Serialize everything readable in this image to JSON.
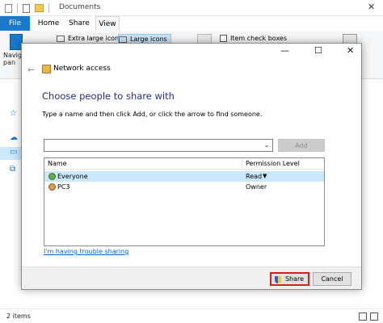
{
  "explorer": {
    "title": "Documents",
    "tabs": {
      "file": "File",
      "home": "Home",
      "share": "Share",
      "view": "View"
    },
    "ribbon": {
      "nav_pane_label": "Navig pan",
      "layout_extra_large": "Extra large icons",
      "layout_large": "Large icons",
      "item_check_boxes": "Item check boxes",
      "window_min": "—",
      "window_max": "□",
      "window_close": "✕"
    },
    "status_items": "2 items"
  },
  "dialog": {
    "title": "Network access",
    "heading": "Choose people to share with",
    "instruction": "Type a name and then click Add, or click the arrow to find someone.",
    "name_input_value": "",
    "add_label": "Add",
    "columns": {
      "name": "Name",
      "permission": "Permission Level"
    },
    "rows": [
      {
        "name": "Everyone",
        "permission": "Read",
        "selected": true
      },
      {
        "name": "PC3",
        "permission": "Owner",
        "selected": false
      }
    ],
    "trouble_link": "I'm having trouble sharing",
    "share_label": "Share",
    "cancel_label": "Cancel",
    "controls": {
      "min": "—",
      "max": "☐",
      "close": "✕",
      "back": "←"
    }
  },
  "colors": {
    "accent": "#1979ca",
    "heading": "#1e3287",
    "selection": "#cce8ff",
    "highlight_border": "#d31f1f",
    "link": "#0066cc"
  }
}
